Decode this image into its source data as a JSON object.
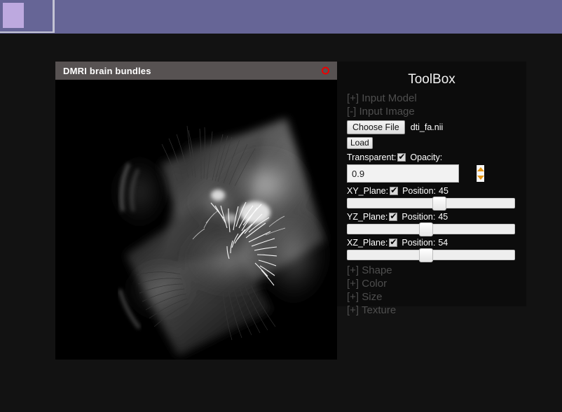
{
  "top_bar": {
    "swatch_color": "#bda9df",
    "bar_color": "#666596"
  },
  "viewer": {
    "title": "DMRI brain bundles",
    "close_icon": "close-circle-icon",
    "canvas_background": "#000000",
    "render_description": "DTI brain slices with white fiber bundles"
  },
  "toolbox": {
    "title": "ToolBox",
    "sections": [
      {
        "name": "input-model",
        "marker": "[+]",
        "label": "[+] Input Model",
        "expanded": false
      },
      {
        "name": "input-image",
        "marker": "[-]",
        "label": "[-] Input Image",
        "expanded": true
      },
      {
        "name": "shape",
        "marker": "[+]",
        "label": "[+] Shape",
        "expanded": false
      },
      {
        "name": "color",
        "marker": "[+]",
        "label": "[+] Color",
        "expanded": false
      },
      {
        "name": "size",
        "marker": "[+]",
        "label": "[+] Size",
        "expanded": false
      },
      {
        "name": "texture",
        "marker": "[+]",
        "label": "[+] Texture",
        "expanded": false
      }
    ],
    "file_input": {
      "button_label": "Choose File",
      "file_name": "dti_fa.nii"
    },
    "load_button_label": "Load",
    "transparent": {
      "label": "Transparent:",
      "checked": true
    },
    "opacity": {
      "label": "Opacity:",
      "value": "0.9",
      "spinner_color": "#e79612"
    },
    "planes": [
      {
        "name": "xy-plane",
        "label": "XY_Plane:",
        "checked": true,
        "position_label": "Position:",
        "position_value": "45",
        "thumb_percent": 55
      },
      {
        "name": "yz-plane",
        "label": "YZ_Plane:",
        "checked": true,
        "position_label": "Position:",
        "position_value": "45",
        "thumb_percent": 47
      },
      {
        "name": "xz-plane",
        "label": "XZ_Plane:",
        "checked": true,
        "position_label": "Position:",
        "position_value": "54",
        "thumb_percent": 47
      }
    ]
  }
}
